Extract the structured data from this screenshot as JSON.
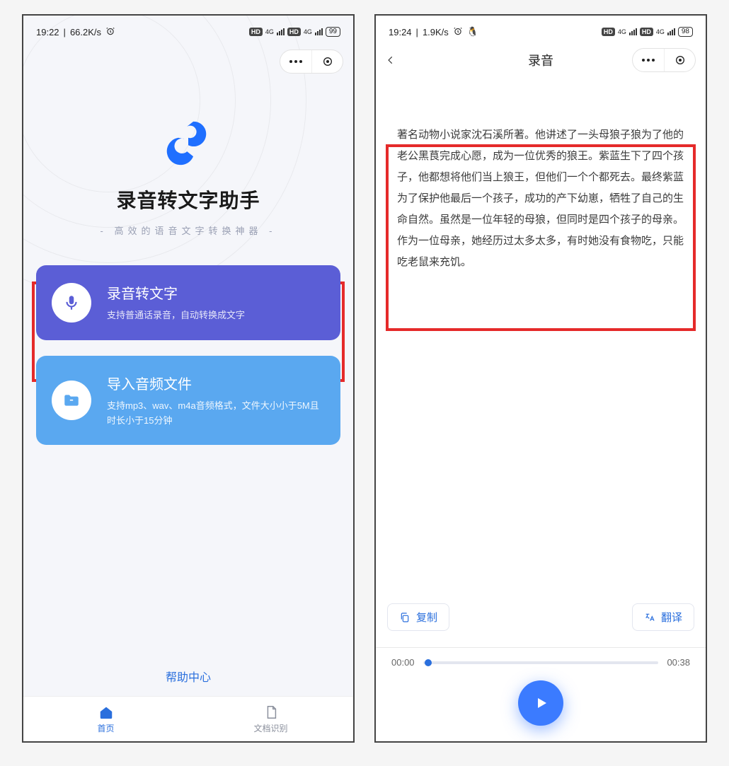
{
  "left": {
    "status": {
      "time": "19:22",
      "net": "66.2K/s",
      "battery": "99",
      "hd": "HD",
      "sig4g": "4G"
    },
    "app_title": "录音转文字助手",
    "app_subtitle": "- 高效的语音文字转换神器 -",
    "card_record": {
      "title": "录音转文字",
      "desc": "支持普通话录音，自动转换成文字"
    },
    "card_import": {
      "title": "导入音频文件",
      "desc": "支持mp3、wav、m4a音频格式，文件大小小于5M且时长小于15分钟"
    },
    "help": "帮助中心",
    "tabs": {
      "home": "首页",
      "doc": "文档识别"
    }
  },
  "right": {
    "status": {
      "time": "19:24",
      "net": "1.9K/s",
      "battery": "98",
      "hd": "HD",
      "sig4g": "4G"
    },
    "page_title": "录音",
    "transcript": "著名动物小说家沈石溪所著。他讲述了一头母狼子狼为了他的老公黑茛完成心愿，成为一位优秀的狼王。紫蓝生下了四个孩子，他都想将他们当上狼王，但他们一个个都死去。最终紫蓝为了保护他最后一个孩子，成功的产下幼崽，牺牲了自己的生命自然。虽然是一位年轻的母狼，但同时是四个孩子的母亲。作为一位母亲，她经历过太多太多，有时她没有食物吃，只能吃老鼠来充饥。",
    "actions": {
      "copy": "复制",
      "translate": "翻译"
    },
    "player": {
      "cur": "00:00",
      "dur": "00:38"
    }
  }
}
